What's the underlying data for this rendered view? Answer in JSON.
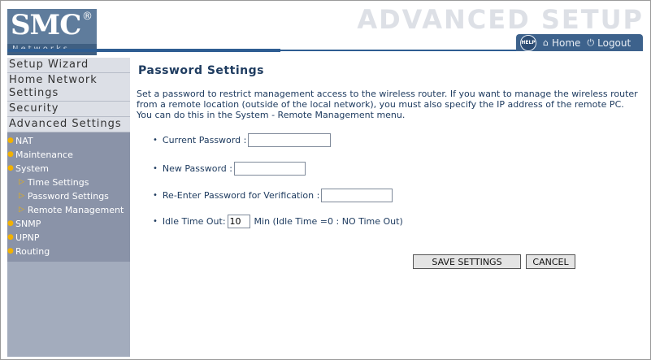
{
  "header": {
    "logo": "SMC",
    "logo_reg": "®",
    "logo_sub": "Networks",
    "title": "ADVANCED SETUP",
    "help_label": "HELP",
    "home_label": "Home",
    "logout_label": "Logout"
  },
  "sidebar": {
    "main_items": [
      "Setup Wizard",
      "Home Network Settings",
      "Security",
      "Advanced Settings"
    ],
    "sub_items": [
      "NAT",
      "Maintenance",
      "System",
      "SNMP",
      "UPNP",
      "Routing"
    ],
    "system_items": [
      "Time Settings",
      "Password Settings",
      "Remote Management"
    ]
  },
  "content": {
    "title": "Password Settings",
    "intro": "Set a password to restrict management access to the wireless router. If you want to manage the wireless router from a remote location (outside of the local network), you must also specify the IP address of the remote PC. You can do this in the System - Remote Management menu.",
    "current_password_label": "Current Password :",
    "current_password_value": "",
    "new_password_label": "New Password :",
    "new_password_value": "",
    "reenter_password_label": "Re-Enter Password for Verification :",
    "reenter_password_value": "",
    "idle_timeout_label": "Idle Time Out:",
    "idle_timeout_value": "10",
    "idle_timeout_note": "Min (Idle Time =0 : NO Time Out)",
    "save_label": "SAVE SETTINGS",
    "cancel_label": "CANCEL"
  },
  "colors": {
    "brand_blue": "#2e5d92",
    "sidebar_bg": "#8a93a8",
    "accent_orange": "#f2b100",
    "text_navy": "#1f3c60"
  }
}
